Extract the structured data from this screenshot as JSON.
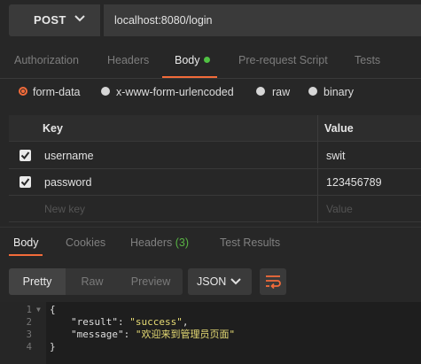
{
  "request": {
    "method": "POST",
    "url": "localhost:8080/login"
  },
  "request_tabs": [
    {
      "label": "Authorization"
    },
    {
      "label": "Headers"
    },
    {
      "label": "Body",
      "active": true,
      "indicator_color": "#50c143"
    },
    {
      "label": "Pre-request Script"
    },
    {
      "label": "Tests"
    }
  ],
  "body_types": [
    {
      "label": "form-data",
      "selected": true
    },
    {
      "label": "x-www-form-urlencoded",
      "selected": false
    },
    {
      "label": "raw",
      "selected": false
    },
    {
      "label": "binary",
      "selected": false
    }
  ],
  "kv_table": {
    "headers": {
      "key": "Key",
      "value": "Value"
    },
    "rows": [
      {
        "checked": true,
        "key": "username",
        "value": "swit"
      },
      {
        "checked": true,
        "key": "password",
        "value": "123456789"
      }
    ],
    "new_key_placeholder": "New key",
    "new_value_placeholder": "Value"
  },
  "response_tabs": [
    {
      "label": "Body",
      "active": true
    },
    {
      "label": "Cookies"
    },
    {
      "label": "Headers",
      "count": "(3)"
    },
    {
      "label": "Test Results"
    }
  ],
  "view_modes": [
    {
      "label": "Pretty",
      "active": true
    },
    {
      "label": "Raw"
    },
    {
      "label": "Preview"
    }
  ],
  "format": "JSON",
  "wrap_icon": "wrap-lines-icon",
  "code_lines": [
    {
      "num": "1",
      "text": "{"
    },
    {
      "num": "2",
      "key": "\"result\"",
      "value": "\"success\"",
      "tail": ","
    },
    {
      "num": "3",
      "key": "\"message\"",
      "value": "\"欢迎来到管理员页面\"",
      "tail": ""
    },
    {
      "num": "4",
      "text": "}"
    }
  ],
  "colors": {
    "accent": "#f26b3a",
    "success": "#50c143",
    "background": "#272727"
  }
}
